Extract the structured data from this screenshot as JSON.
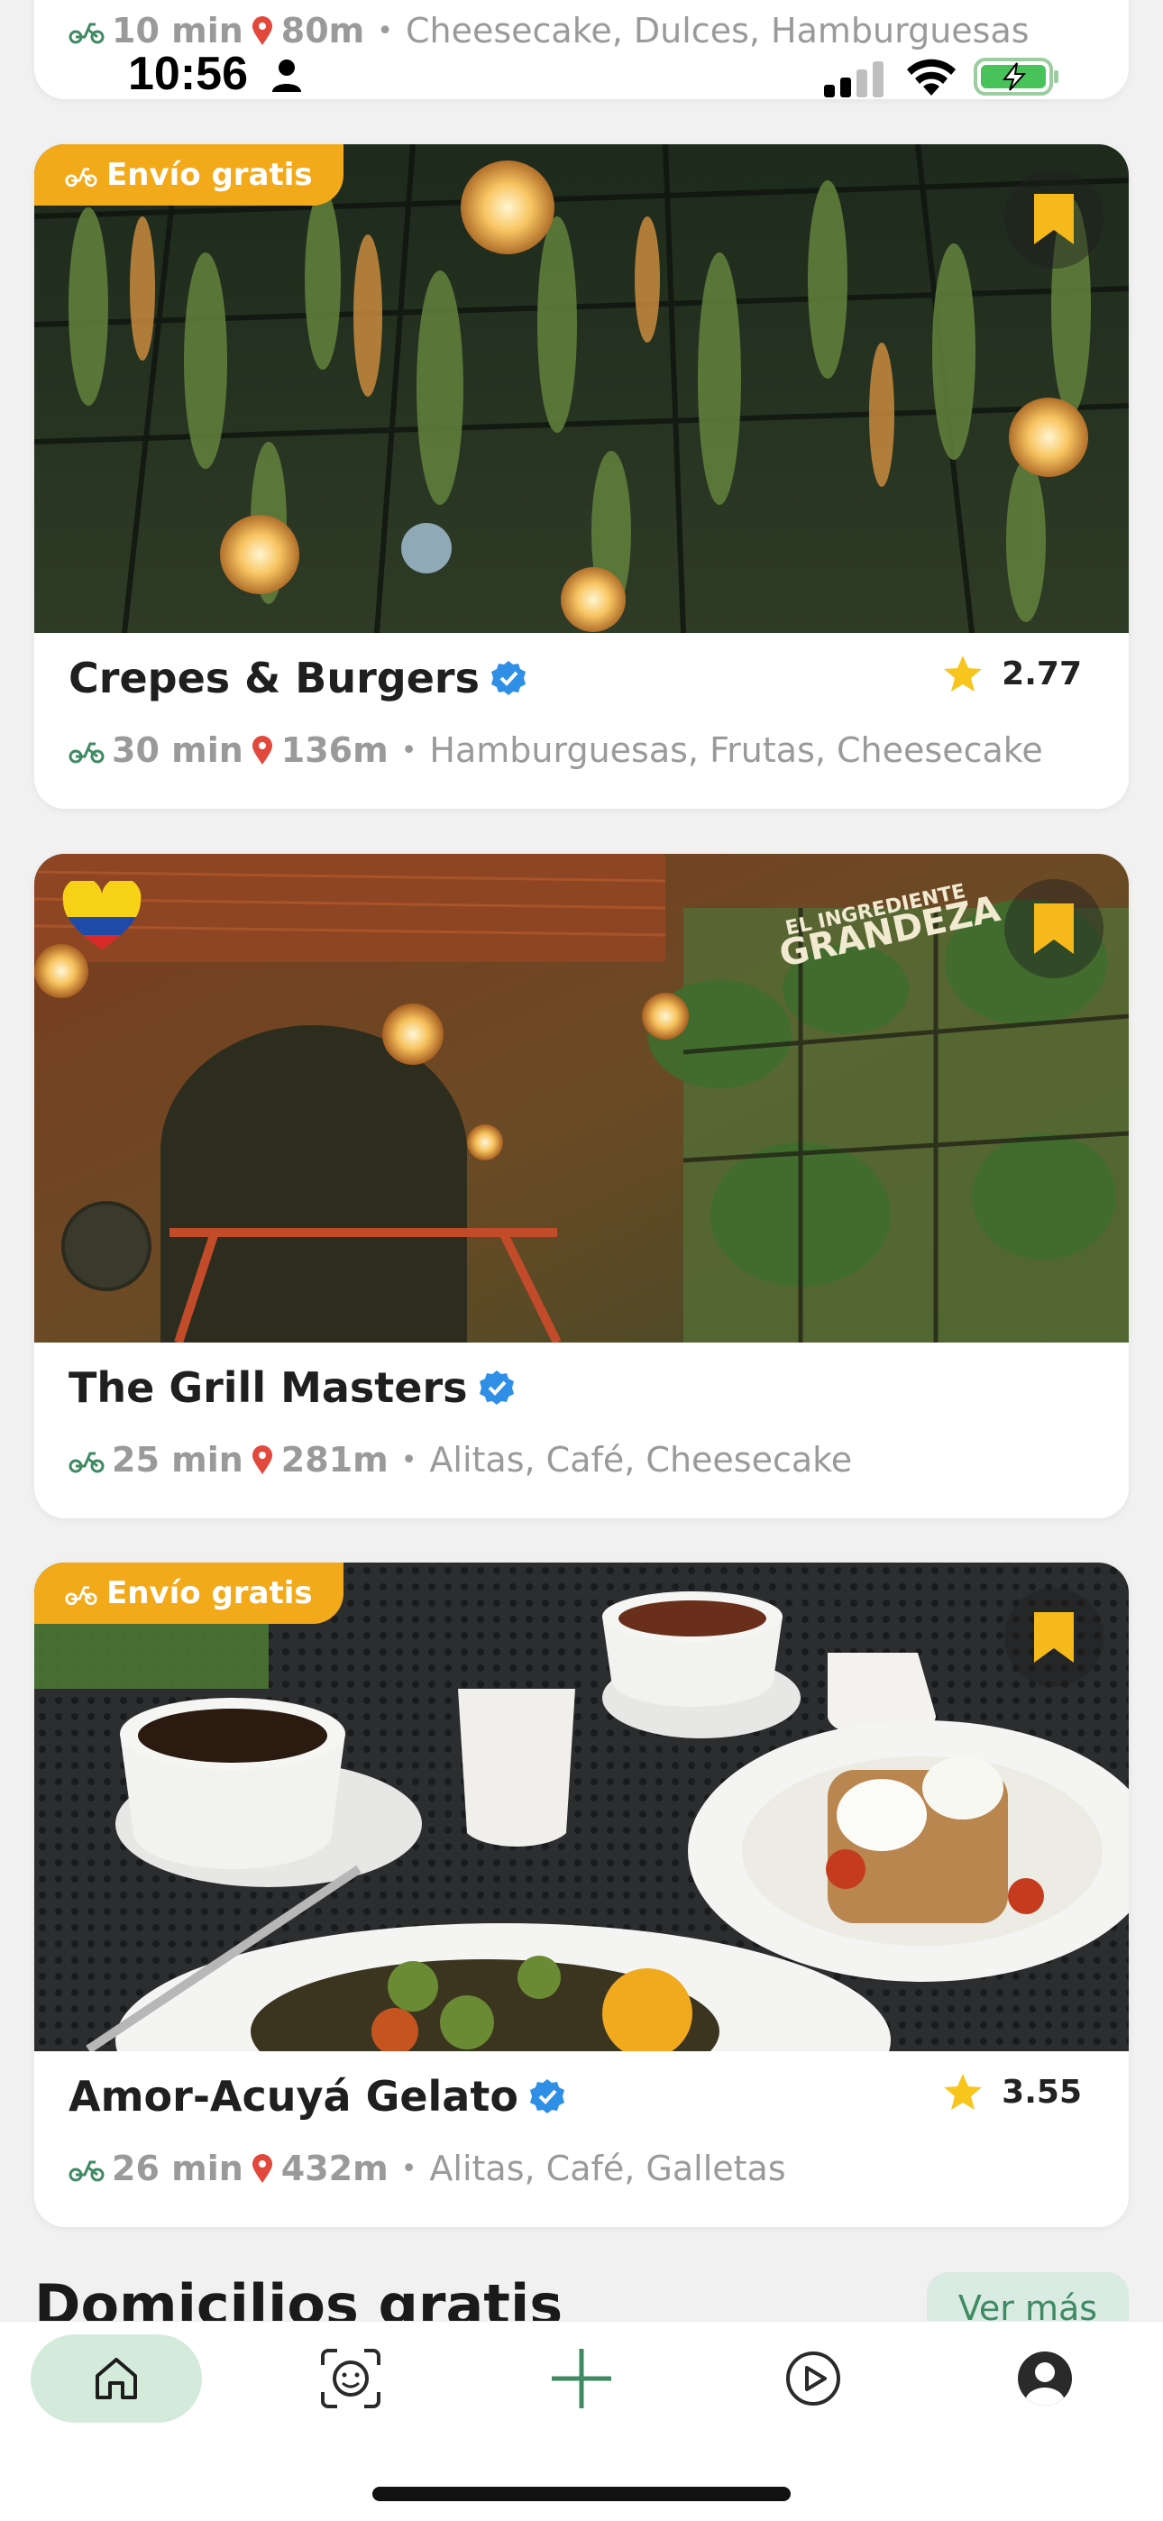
{
  "status_bar": {
    "time": "10:56"
  },
  "top_card": {
    "time": "10 min",
    "distance": "80m",
    "categories": "Cheesecake, Dulces, Hamburguesas"
  },
  "cards": [
    {
      "badge": "Envío gratis",
      "name": "Crepes & Burgers",
      "rating": "2.77",
      "time": "30 min",
      "distance": "136m",
      "categories": "Hamburguesas, Frutas, Cheesecake"
    },
    {
      "badge": "",
      "name": "The Grill Masters",
      "rating": "",
      "time": "25 min",
      "distance": "281m",
      "categories": "Alitas, Café, Cheesecake",
      "mural_text_line1": "EL INGREDIENTE",
      "mural_text_line2": "GRANDEZA"
    },
    {
      "badge": "Envío gratis",
      "name": "Amor-Acuyá Gelato",
      "rating": "3.55",
      "time": "26 min",
      "distance": "432m",
      "categories": "Alitas, Café, Galletas"
    }
  ],
  "section": {
    "title": "Domicilios gratis",
    "see_more": "Ver más"
  },
  "colors": {
    "accent_green": "#3f8a63",
    "badge_orange": "#f3aa1a",
    "bookmark_yellow": "#f6b91c",
    "star_yellow": "#f7c51e",
    "verified_blue": "#2f8fe6",
    "pin_red": "#e2483b"
  },
  "icons": {
    "delivery": "scooter-icon",
    "location": "location-pin-icon",
    "verified": "verified-badge-icon",
    "bookmark": "bookmark-icon",
    "rating": "star-icon",
    "nav": [
      "home-icon",
      "face-scan-icon",
      "plus-icon",
      "play-icon",
      "profile-icon"
    ]
  }
}
